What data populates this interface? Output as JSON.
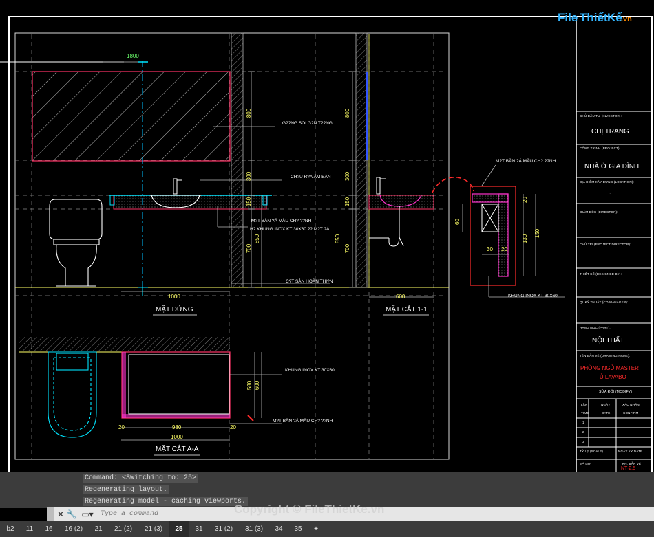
{
  "logo": {
    "file": "File",
    "thiet": "Thiết",
    "ke": "Kế",
    "vn": ".vn"
  },
  "drawing": {
    "dims": {
      "d1800": "1800",
      "d800a": "800",
      "d300a": "300",
      "d150a": "150",
      "d850a": "850",
      "d700a": "700",
      "d1000a": "1000",
      "d800b": "800",
      "d300b": "300",
      "d150b": "150",
      "d850b": "850",
      "d700b": "700",
      "d600": "600",
      "d20a": "20",
      "d60": "60",
      "d130": "130",
      "d150c": "150",
      "d30": "30",
      "d20b": "20",
      "d580": "580",
      "d600b": "600",
      "d20c": "20",
      "d980": "980",
      "d20d": "20",
      "d1000b": "1000"
    },
    "notes": {
      "guong": "G??NG SOI G?N T??NG",
      "chau": "CH?U R?A ÂM BÀN",
      "matban": "M?T BÀN ?Á MÀU CH? ??NH",
      "khung": "H? KHUNG INOX KT 30X60 ?? M?T ?Á",
      "cos": "C?T SÀN HOÀN THI?N",
      "matban_detail": "M?T BÀN ?Á MÀU CH? ??NH",
      "khung_detail": "KHUNG INOX KT 30X60",
      "khung_aa": "KHUNG INOX KT 30X60",
      "matban_aa": "M?T BÀN ?Á MÀU CH? ??NH"
    },
    "views": {
      "mat_dung": "MẶT ĐỨNG",
      "mat_cat_11": "MẶT CẮT 1-1",
      "mat_cat_aa": "MẶT CẮT A-A"
    }
  },
  "title_block": {
    "investor_label": "CHỦ ĐẦU TƯ (INVESTOR):",
    "investor": "CHỊ TRANG",
    "project_label": "CÔNG TRÌNH (PROJECT):",
    "project": "NHÀ Ở GIA ĐÌNH",
    "location_label": "ĐỊA ĐIỂM XÂY DỰNG (LOCATION):",
    "location": "...",
    "director_label": "GIÁM ĐỐC (DIRECTOR):",
    "pd_label": "CHỦ TRÌ (PROJECT DIRECTOR):",
    "designer_label": "THIẾT KẾ (DESIGNED BY):",
    "manager_label": "QL KỸ THUẬT (CO.MANAGER):",
    "part_label": "HẠNG MỤC (PART):",
    "part": "NỘI THẤT",
    "drawing_label": "TÊN BẢN VẼ (DRAWING NAME):",
    "drawing_line1": "PHÒNG NGỦ MASTER",
    "drawing_line2": "TỦ LAVABO",
    "modify_label": "SỬA ĐỔI (MODIFY)",
    "rev_col1": "LẦN",
    "rev_col1b": "TIME",
    "rev_col2": "NGÀY",
    "rev_col2b": "DATE",
    "rev_col3": "XÁC NHẬN",
    "rev_col3b": "CONFIRM",
    "rev_rows": [
      "1",
      "2",
      "3"
    ],
    "scale_label": "TỶ LỆ (SCALE)",
    "date_label": "NGÀY KÝ DATE",
    "no_label": "SỐ HỢ",
    "sheet_label": "KH. BẢN VẼ",
    "sheet": "NT-2.5"
  },
  "command": {
    "history": [
      "Command:  <Switching to: 25>",
      "Regenerating layout.",
      "Regenerating model - caching viewports."
    ],
    "placeholder": "Type a command"
  },
  "tabs": [
    "b2",
    "11",
    "16",
    "16 (2)",
    "21",
    "21 (2)",
    "21 (3)",
    "25",
    "31",
    "31 (2)",
    "31 (3)",
    "34",
    "35",
    "+"
  ],
  "active_tab": "25",
  "watermark": "Copyright © FileThietKe.vn"
}
